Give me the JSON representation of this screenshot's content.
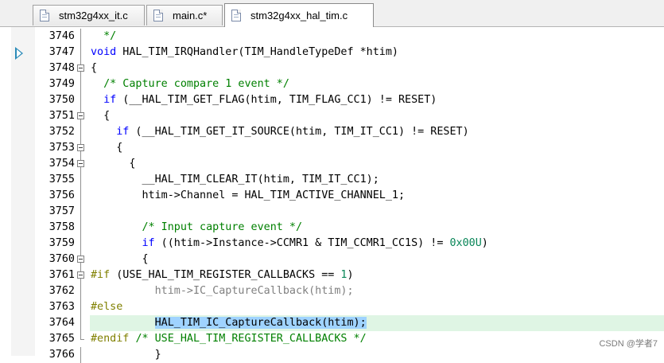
{
  "tabs": [
    {
      "label": "stm32g4xx_it.c"
    },
    {
      "label": "main.c*"
    },
    {
      "label": "stm32g4xx_hal_tim.c"
    }
  ],
  "editor": {
    "lines": [
      {
        "num": "3746",
        "fold": "line",
        "segs": [
          {
            "t": "  */",
            "c": "cm"
          }
        ]
      },
      {
        "num": "3747",
        "fold": "line",
        "segs": [
          {
            "t": "void",
            "c": "kw"
          },
          {
            "t": " HAL_TIM_IRQHandler(TIM_HandleTypeDef *htim)",
            "c": ""
          }
        ]
      },
      {
        "num": "3748",
        "fold": "box",
        "segs": [
          {
            "t": "{",
            "c": ""
          }
        ]
      },
      {
        "num": "3749",
        "fold": "line",
        "segs": [
          {
            "t": "  ",
            "c": ""
          },
          {
            "t": "/* Capture compare 1 event */",
            "c": "cm"
          }
        ]
      },
      {
        "num": "3750",
        "fold": "line",
        "segs": [
          {
            "t": "  ",
            "c": ""
          },
          {
            "t": "if",
            "c": "kw"
          },
          {
            "t": " (__HAL_TIM_GET_FLAG(htim, TIM_FLAG_CC1) != RESET)",
            "c": ""
          }
        ]
      },
      {
        "num": "3751",
        "fold": "box",
        "segs": [
          {
            "t": "  {",
            "c": ""
          }
        ]
      },
      {
        "num": "3752",
        "fold": "line",
        "segs": [
          {
            "t": "    ",
            "c": ""
          },
          {
            "t": "if",
            "c": "kw"
          },
          {
            "t": " (__HAL_TIM_GET_IT_SOURCE(htim, TIM_IT_CC1) != RESET)",
            "c": ""
          }
        ]
      },
      {
        "num": "3753",
        "fold": "box",
        "segs": [
          {
            "t": "    {",
            "c": ""
          }
        ]
      },
      {
        "num": "3754",
        "fold": "box",
        "segs": [
          {
            "t": "      {",
            "c": ""
          }
        ]
      },
      {
        "num": "3755",
        "fold": "line",
        "segs": [
          {
            "t": "        __HAL_TIM_CLEAR_IT(htim, TIM_IT_CC1);",
            "c": ""
          }
        ]
      },
      {
        "num": "3756",
        "fold": "line",
        "segs": [
          {
            "t": "        htim->Channel = HAL_TIM_ACTIVE_CHANNEL_1;",
            "c": ""
          }
        ]
      },
      {
        "num": "3757",
        "fold": "line",
        "segs": []
      },
      {
        "num": "3758",
        "fold": "line",
        "segs": [
          {
            "t": "        ",
            "c": ""
          },
          {
            "t": "/* Input capture event */",
            "c": "cm"
          }
        ]
      },
      {
        "num": "3759",
        "fold": "line",
        "segs": [
          {
            "t": "        ",
            "c": ""
          },
          {
            "t": "if",
            "c": "kw"
          },
          {
            "t": " ((htim->Instance->CCMR1 & TIM_CCMR1_CC1S) != ",
            "c": ""
          },
          {
            "t": "0x00U",
            "c": "num"
          },
          {
            "t": ")",
            "c": ""
          }
        ]
      },
      {
        "num": "3760",
        "fold": "box",
        "segs": [
          {
            "t": "        {",
            "c": ""
          }
        ]
      },
      {
        "num": "3761",
        "fold": "box",
        "segs": [
          {
            "t": "#if",
            "c": "pp"
          },
          {
            "t": " (USE_HAL_TIM_REGISTER_CALLBACKS == ",
            "c": ""
          },
          {
            "t": "1",
            "c": "num"
          },
          {
            "t": ")",
            "c": ""
          }
        ]
      },
      {
        "num": "3762",
        "fold": "line",
        "segs": [
          {
            "t": "          htim->IC_CaptureCallback(htim);",
            "c": "gray"
          }
        ]
      },
      {
        "num": "3763",
        "fold": "line",
        "segs": [
          {
            "t": "#else",
            "c": "pp"
          }
        ]
      },
      {
        "num": "3764",
        "fold": "line",
        "hl": true,
        "segs": [
          {
            "t": "          ",
            "c": ""
          },
          {
            "t": "HAL_TIM_IC_CaptureCallback(htim);",
            "c": "sel"
          }
        ]
      },
      {
        "num": "3765",
        "fold": "end",
        "segs": [
          {
            "t": "#endif",
            "c": "pp"
          },
          {
            "t": " ",
            "c": ""
          },
          {
            "t": "/* USE_HAL_TIM_REGISTER_CALLBACKS */",
            "c": "cm"
          }
        ]
      },
      {
        "num": "3766",
        "fold": "line",
        "segs": [
          {
            "t": "          }",
            "c": ""
          }
        ]
      }
    ]
  },
  "watermark": "CSDN @学者7",
  "colors": {
    "keyword": "#0000ff",
    "comment": "#008000",
    "number": "#098658",
    "preprocessor": "#808000",
    "line_highlight": "#dff5e4",
    "selection": "#9fd3ff"
  },
  "icons": {
    "tab_file": "file-icon",
    "current_line": "execution-arrow-icon",
    "fold": "fold-collapse-icon"
  }
}
